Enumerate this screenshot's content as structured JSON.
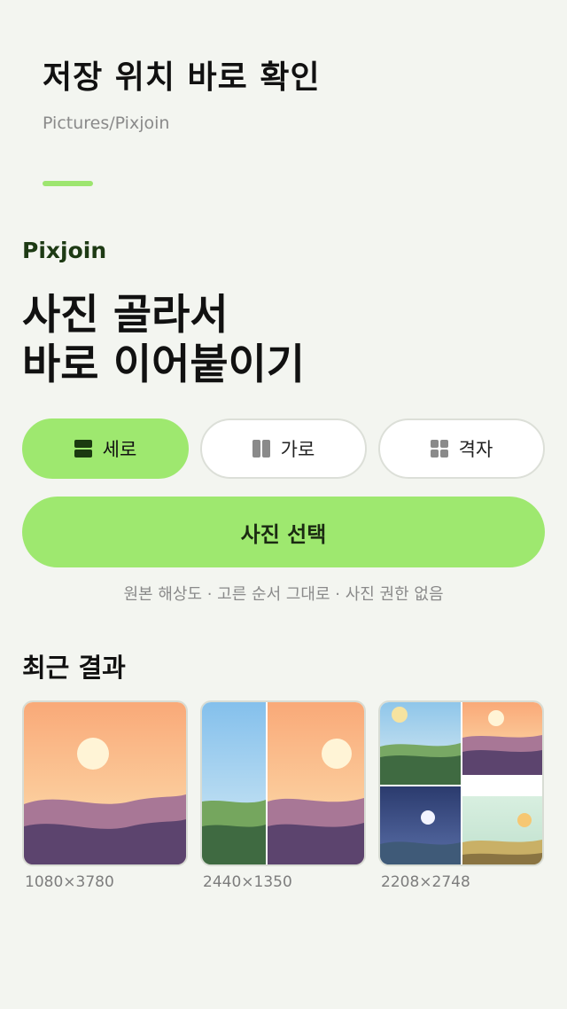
{
  "header": {
    "title": "저장 위치 바로 확인",
    "path": "Pictures/Pixjoin"
  },
  "app": {
    "name": "Pixjoin",
    "hero_line1": "사진 골라서",
    "hero_line2": "바로 이어붙이기"
  },
  "modes": [
    {
      "label": "세로",
      "icon": "rows-icon",
      "active": true
    },
    {
      "label": "가로",
      "icon": "columns-icon",
      "active": false
    },
    {
      "label": "격자",
      "icon": "grid-icon",
      "active": false
    }
  ],
  "pick_button": {
    "label": "사진 선택"
  },
  "pick_caption": "원본 해상도 · 고른 순서 그대로 · 사진 권한 없음",
  "recent": {
    "title": "최근 결과",
    "items": [
      {
        "size": "1080×3780",
        "thumbnail": "vertical-sunset"
      },
      {
        "size": "2440×1350",
        "thumbnail": "horizontal-pair"
      },
      {
        "size": "2208×2748",
        "thumbnail": "grid-four"
      }
    ]
  },
  "colors": {
    "accent": "#9ee86f",
    "background": "#f3f5f0",
    "brand_dark": "#1d3a14"
  }
}
